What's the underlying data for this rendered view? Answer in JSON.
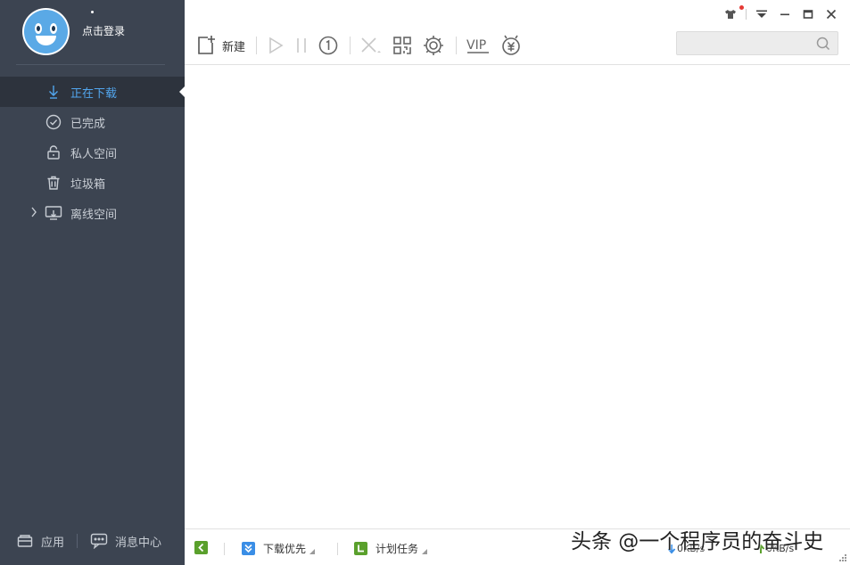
{
  "sidebar": {
    "login_text": "点击登录",
    "items": [
      {
        "label": "正在下载",
        "icon": "download-arrow-icon",
        "active": true
      },
      {
        "label": "已完成",
        "icon": "check-circle-icon"
      },
      {
        "label": "私人空间",
        "icon": "lock-icon"
      },
      {
        "label": "垃圾箱",
        "icon": "trash-icon"
      },
      {
        "label": "离线空间",
        "icon": "cloud-offline-icon",
        "expandable": true
      }
    ],
    "bottom": {
      "apps_label": "应用",
      "messages_label": "消息中心"
    }
  },
  "toolbar": {
    "new_label": "新建",
    "vip_label": "VIP"
  },
  "search": {
    "placeholder": ""
  },
  "statusbar": {
    "priority_label": "下载优先",
    "schedule_label": "计划任务",
    "download_speed": "0KB/s",
    "upload_speed": "0KB/s"
  },
  "watermark": "头条 @一个程序员的奋斗史",
  "colors": {
    "sidebar_bg": "#3c4451",
    "active_item_bg": "#2d333d",
    "accent_blue": "#52a6ee",
    "status_green": "#5aa02c",
    "status_blue": "#3a8ee6"
  }
}
